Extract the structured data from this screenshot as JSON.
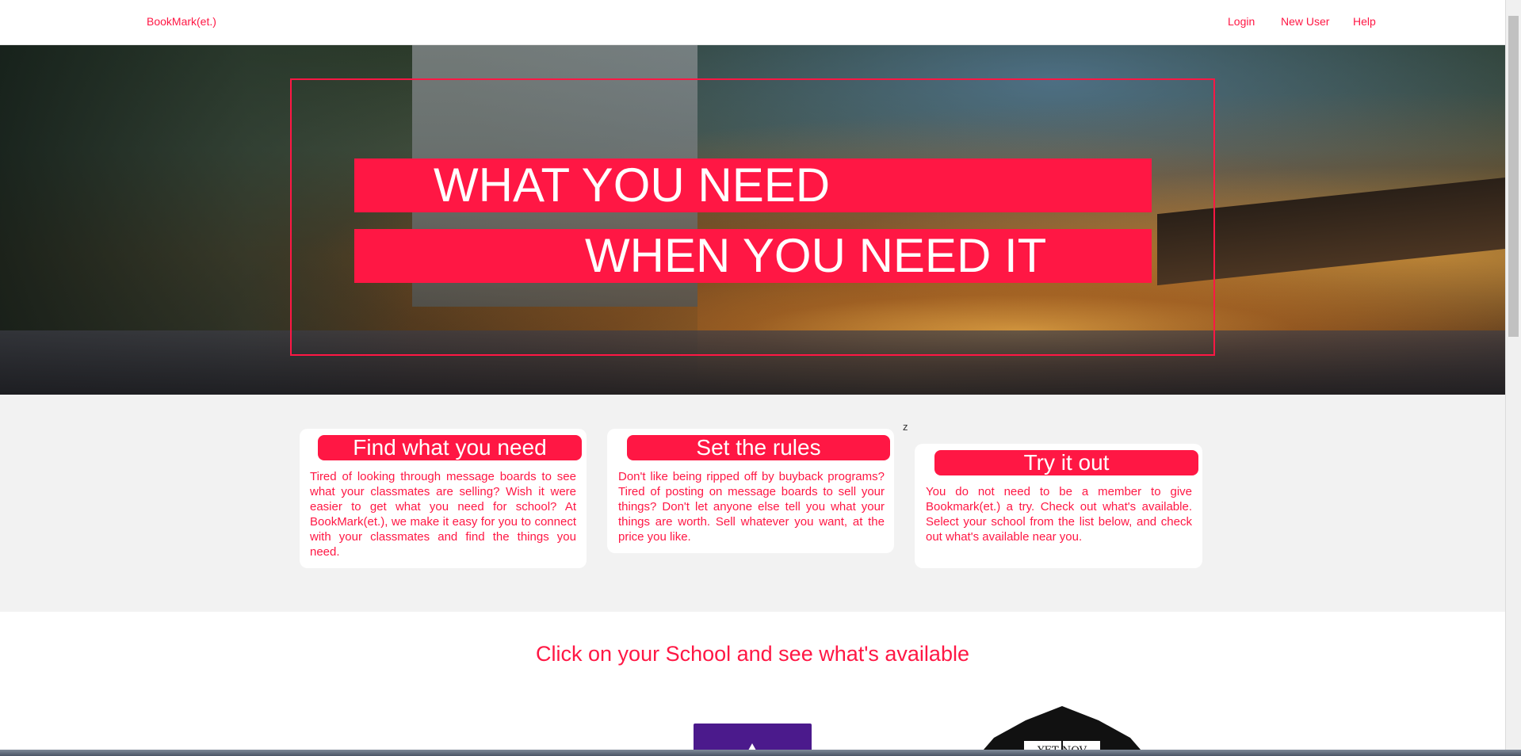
{
  "navbar": {
    "brand": "BookMark(et.)",
    "links": [
      "Login",
      "New User",
      "Help"
    ]
  },
  "hero": {
    "line1": "WHAT YOU NEED",
    "line2": "WHEN YOU NEED IT"
  },
  "features": [
    {
      "title": "Find what you need",
      "text": "Tired of looking through message boards to see what your classmates are selling? Wish it were easier to get what you need for school? At BookMark(et.), we make it easy for you to connect with your classmates and find the things you need."
    },
    {
      "title": "Set the rules",
      "text": "Don't like being ripped off by buyback programs? Tired of posting on message boards to sell your things? Don't let anyone else tell you what your things are worth. Sell whatever you want, at the price you like."
    },
    {
      "title": "Try it out",
      "text": "You do not need to be a member to give Bookmark(et.) a try. Check out what's available. Select your school from the list below, and check out what's available near you."
    }
  ],
  "stray_char": "z",
  "schools": {
    "heading": "Click on your School and see what's available",
    "logo2_text": "YET NOV"
  },
  "colors": {
    "accent": "#ff1744",
    "section_bg": "#f2f2f2",
    "logo1": "#4b1a8c"
  }
}
